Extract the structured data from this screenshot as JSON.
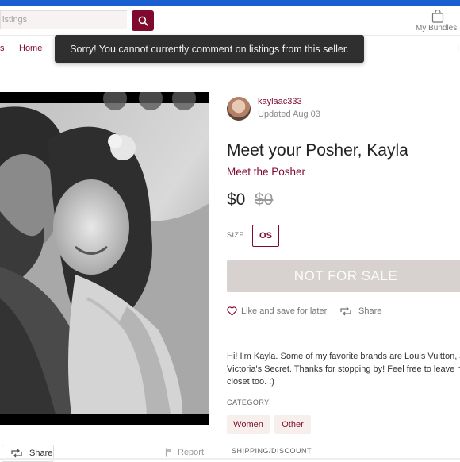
{
  "header": {
    "search_placeholder": "istings",
    "bundles_label": "My Bundles"
  },
  "nav": {
    "items": [
      {
        "label": "s"
      },
      {
        "label": "Home"
      },
      {
        "label": "I"
      }
    ]
  },
  "toast": {
    "message": "Sorry! You cannot currently comment on listings from this seller."
  },
  "listing": {
    "seller": {
      "username": "kaylaac333",
      "updated": "Updated Aug 03"
    },
    "title": "Meet your Posher, Kayla",
    "meet_link": "Meet the Posher",
    "price": "$0",
    "original_price": "$0",
    "size_label": "SIZE",
    "size_value": "OS",
    "not_for_sale_label": "NOT FOR SALE",
    "like_label": "Like and save for later",
    "share_label": "Share",
    "description": "Hi! I'm Kayla. Some of my favorite brands are Louis Vuitton, J. C Victoria's Secret. Thanks for stopping by! Feel free to leave me closet too. :)",
    "category_label": "CATEGORY",
    "categories": [
      "Women",
      "Other"
    ],
    "shipping_label": "SHIPPING/DISCOUNT"
  },
  "photo_actions": {
    "share_label": "Share",
    "report_label": "Report"
  },
  "colors": {
    "brand": "#7f0a2e",
    "top_bar": "#1a5fd0",
    "toast_bg": "#2f2f2f",
    "disabled_button": "#d7d1cf"
  }
}
